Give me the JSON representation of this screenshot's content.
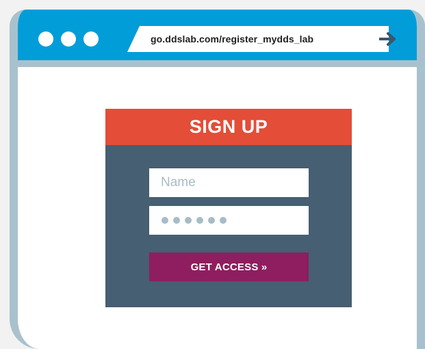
{
  "browser": {
    "url": "go.ddslab.com/register_mydds_lab",
    "icons": {
      "window_dots": "traffic-light-dots",
      "go": "arrow-right-icon"
    },
    "colors": {
      "titlebar": "#009dd9",
      "frame": "#a9c1cc"
    }
  },
  "signup": {
    "title": "SIGN UP",
    "name_placeholder": "Name",
    "password_mask_length": 6,
    "submit_label": "GET ACCESS »",
    "colors": {
      "header": "#e44d37",
      "panel": "#465f72",
      "button": "#8e1e5f"
    }
  }
}
